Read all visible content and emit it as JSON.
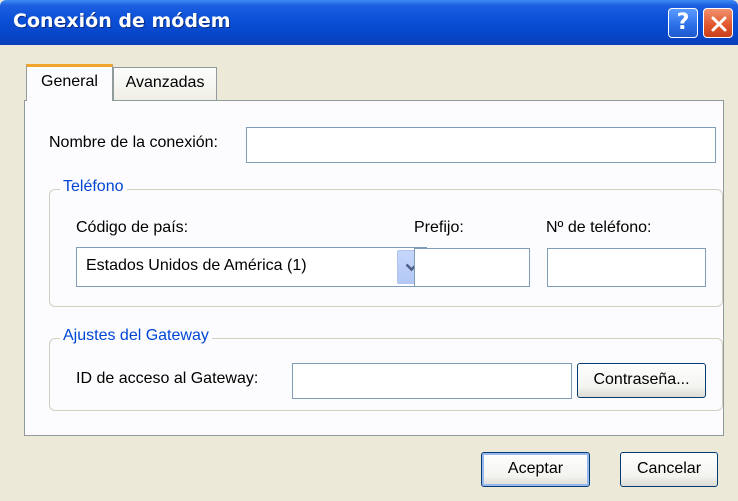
{
  "window": {
    "title": "Conexión de módem",
    "help_glyph": "?",
    "close_icon": "close-icon"
  },
  "tabs": [
    {
      "label": "General",
      "active": true
    },
    {
      "label": "Avanzadas",
      "active": false
    }
  ],
  "connection": {
    "name_label": "Nombre de la conexión:",
    "name_value": ""
  },
  "telefono": {
    "legend": "Teléfono",
    "country_label": "Código de país:",
    "country_value": "Estados Unidos de América (1)",
    "prefix_label": "Prefijo:",
    "prefix_value": "",
    "phone_label": "Nº de teléfono:",
    "phone_value": ""
  },
  "gateway": {
    "legend": "Ajustes del Gateway",
    "access_id_label": "ID de acceso al Gateway:",
    "access_id_value": "",
    "password_button": "Contraseña..."
  },
  "footer": {
    "accept_button": "Aceptar",
    "cancel_button": "Cancelar"
  },
  "colors": {
    "titlebar": "#0a4fd6",
    "active_tab_accent": "#f0a52d",
    "group_legend": "#0046d5",
    "dialog_bg": "#ece9d8"
  }
}
